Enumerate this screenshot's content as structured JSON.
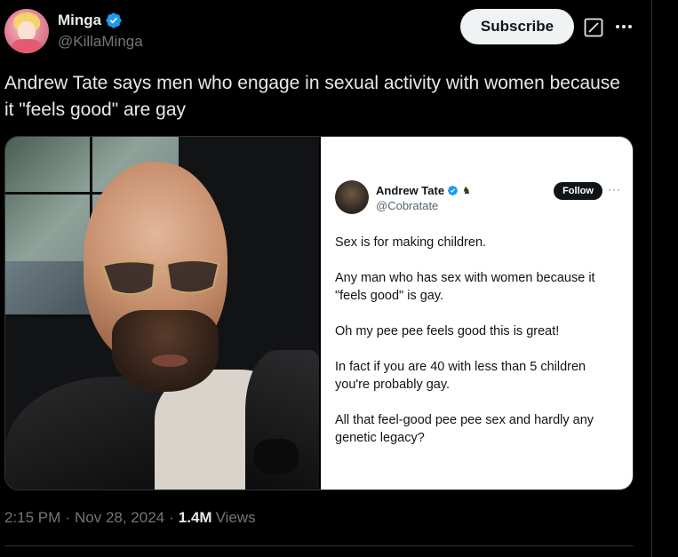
{
  "author": {
    "display_name": "Minga",
    "handle": "@KillaMinga"
  },
  "header": {
    "subscribe_label": "Subscribe"
  },
  "tweet": {
    "text": "Andrew Tate says men who engage in sexual activity with women because it \"feels good\" are gay"
  },
  "embedded_post": {
    "display_name": "Andrew Tate",
    "handle": "@Cobratate",
    "badge": "♞",
    "follow_label": "Follow",
    "more_label": "···",
    "paragraphs": [
      "Sex is for making children.",
      "Any man who has sex with women because it \"feels good\" is gay.",
      "Oh my pee pee feels good this is great!",
      "In fact if you are 40 with less than 5 children you're probably gay.",
      "All that feel-good pee pee sex and hardly any genetic legacy?"
    ]
  },
  "meta": {
    "time": "2:15 PM",
    "date": "Nov 28, 2024",
    "separator": "·",
    "views_count": "1.4M",
    "views_label": "Views"
  },
  "colors": {
    "background": "#000000",
    "text_primary": "#e7e9ea",
    "text_secondary": "#71767b",
    "verified_blue": "#1d9bf0",
    "subscribe_bg": "#eff3f4",
    "border": "#2f3336"
  },
  "icons": {
    "verified": "verified-badge-icon",
    "grok": "grok-icon",
    "more": "more-icon"
  }
}
